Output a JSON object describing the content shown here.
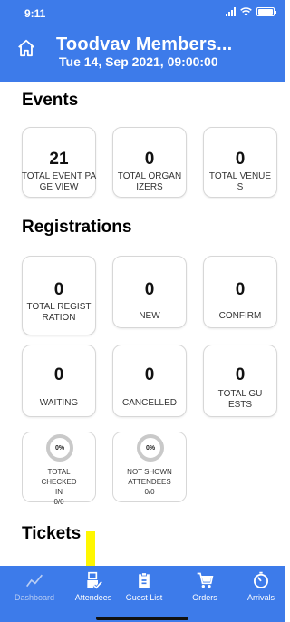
{
  "status_bar": {
    "time": "9:11"
  },
  "header": {
    "title": "Toodvav Members...",
    "subtitle": "Tue 14, Sep 2021, 09:00:00"
  },
  "events": {
    "title": "Events",
    "cards": [
      {
        "value": "21",
        "label": "TOTAL EVENT PAGE VIEW"
      },
      {
        "value": "0",
        "label": "TOTAL ORGANIZERS"
      },
      {
        "value": "0",
        "label": "TOTAL VENUES"
      }
    ]
  },
  "registrations": {
    "title": "Registrations",
    "cards": [
      {
        "value": "0",
        "label": "TOTAL REGISTRATION"
      },
      {
        "value": "0",
        "label": "NEW"
      },
      {
        "value": "0",
        "label": "CONFIRM"
      },
      {
        "value": "0",
        "label": "WAITING"
      },
      {
        "value": "0",
        "label": "CANCELLED"
      },
      {
        "value": "0",
        "label": "TOTAL GUESTS"
      }
    ],
    "progress": [
      {
        "percent": "0%",
        "label": "TOTAL CHECKED IN",
        "count": "0/0",
        "fraction": 0
      },
      {
        "percent": "0%",
        "label": "NOT SHOWN ATTENDEES",
        "count": "0/0",
        "fraction": 0
      }
    ]
  },
  "tickets": {
    "title": "Tickets"
  },
  "tabbar": {
    "items": [
      {
        "label": "Dashboard",
        "icon": "chart-icon",
        "active": false
      },
      {
        "label": "Attendees",
        "icon": "attendees-icon",
        "active": true
      },
      {
        "label": "Guest List",
        "icon": "clipboard-icon",
        "active": true
      },
      {
        "label": "Orders",
        "icon": "cart-icon",
        "active": true
      },
      {
        "label": "Arrivals",
        "icon": "timer-icon",
        "active": true
      }
    ]
  },
  "colors": {
    "brand": "#3d7bea",
    "marker": "#fff700"
  }
}
